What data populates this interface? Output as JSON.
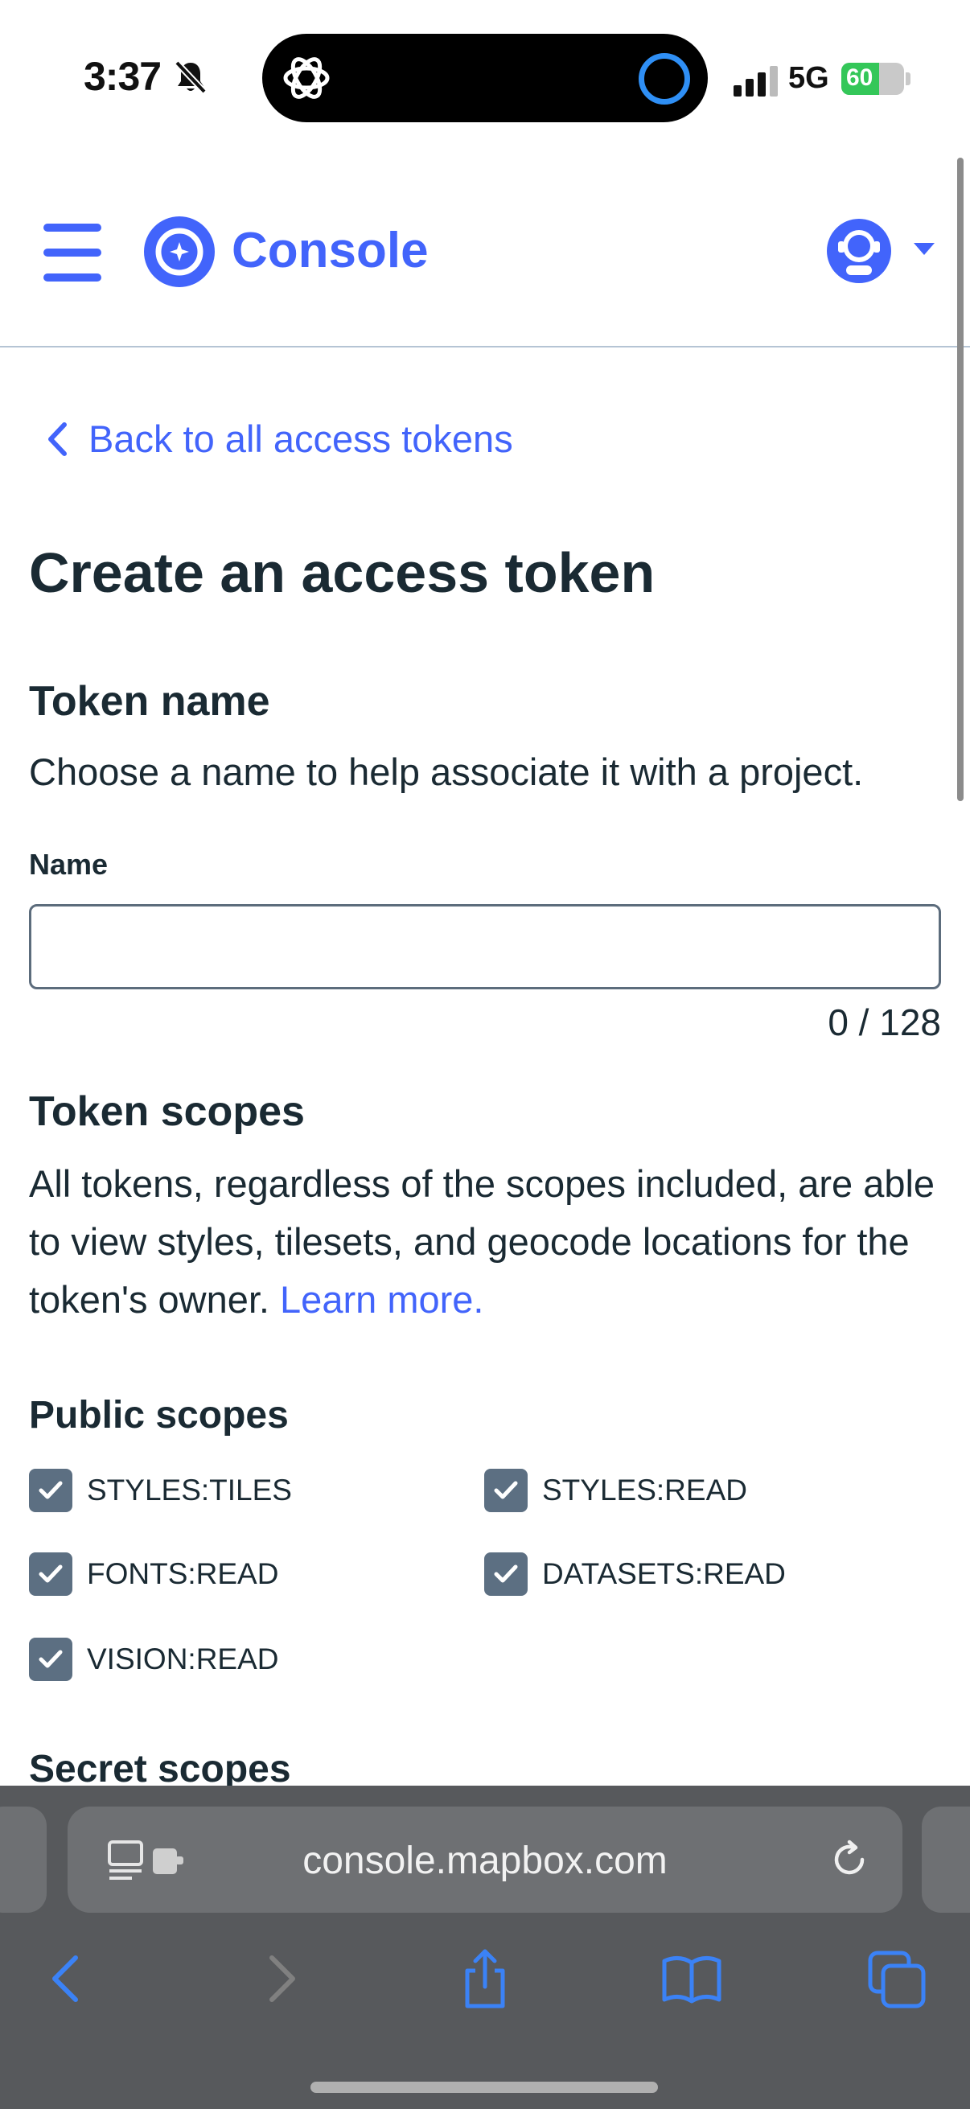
{
  "status_bar": {
    "time": "3:37",
    "network": "5G",
    "battery": "60",
    "battery_level": 0.6
  },
  "header": {
    "brand": "Console"
  },
  "back_link": "Back to all access tokens",
  "page_title": "Create an access token",
  "token_name": {
    "title": "Token name",
    "description": "Choose a name to help associate it with a project.",
    "field_label": "Name",
    "value": "",
    "counter": "0 / 128"
  },
  "token_scopes": {
    "title": "Token scopes",
    "description": "All tokens, regardless of the scopes included, are able to view styles, tilesets, and geocode locations for the token's owner.",
    "learn_more": "Learn more."
  },
  "public_scopes": {
    "title": "Public scopes",
    "items": [
      {
        "label": "STYLES:TILES",
        "checked": true
      },
      {
        "label": "STYLES:READ",
        "checked": true
      },
      {
        "label": "FONTS:READ",
        "checked": true
      },
      {
        "label": "DATASETS:READ",
        "checked": true
      },
      {
        "label": "VISION:READ",
        "checked": true
      }
    ]
  },
  "secret_scopes": {
    "title": "Secret scopes"
  },
  "browser": {
    "url": "console.mapbox.com"
  },
  "colors": {
    "accent": "#4264fb",
    "text": "#1a2a33",
    "checkbox": "#5c6f82",
    "browser_bar": "#57595c"
  }
}
